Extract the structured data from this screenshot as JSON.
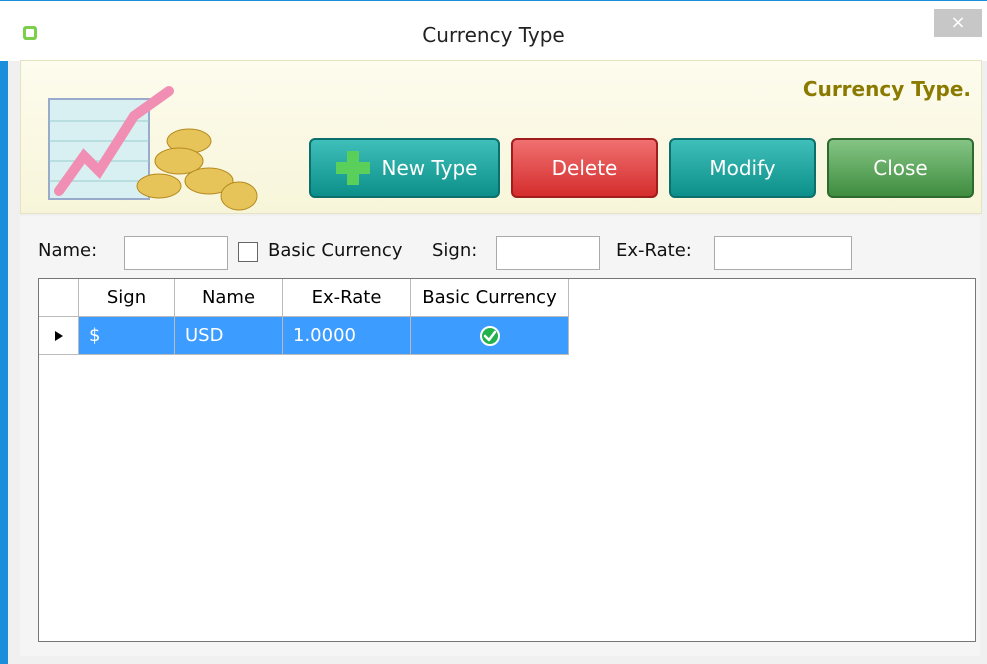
{
  "window": {
    "title": "Currency Type",
    "close_glyph": "×"
  },
  "header": {
    "title": "Currency Type."
  },
  "toolbar": {
    "new_type": "New Type",
    "delete": "Delete",
    "modify": "Modify",
    "close": "Close"
  },
  "form": {
    "name_label": "Name:",
    "basic_currency_label": "Basic Currency",
    "sign_label": "Sign:",
    "exrate_label": "Ex-Rate:",
    "name_value": "",
    "sign_value": "",
    "exrate_value": "",
    "basic_currency_checked": false
  },
  "grid": {
    "columns": [
      "Sign",
      "Name",
      "Ex-Rate",
      "Basic Currency"
    ],
    "rows": [
      {
        "sign": "$",
        "name": "USD",
        "exrate": "1.0000",
        "basic": "check-icon"
      }
    ]
  },
  "colors": {
    "accent_blue": "#1b8fdc",
    "header_title": "#8a7a00",
    "selection": "#3c9cff"
  }
}
